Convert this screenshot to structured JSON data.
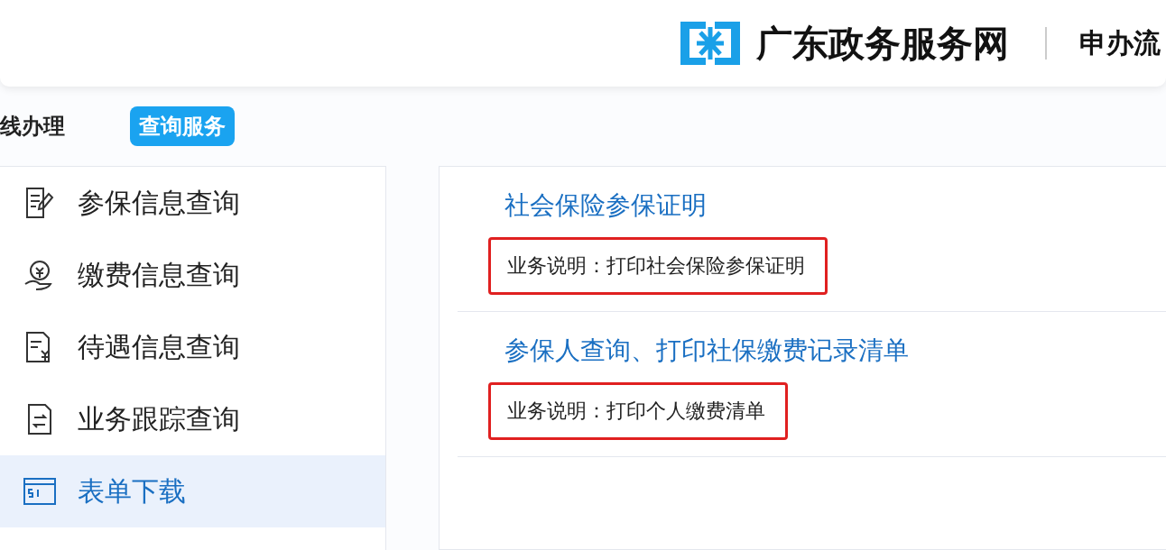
{
  "header": {
    "site_name": "广东政务服务网",
    "nav_link": "申办流"
  },
  "tabs": [
    {
      "label": "线办理",
      "selected": false
    },
    {
      "label": "查询服务",
      "selected": true
    }
  ],
  "sidebar": {
    "items": [
      {
        "label": "参保信息查询",
        "selected": false
      },
      {
        "label": "缴费信息查询",
        "selected": false
      },
      {
        "label": "待遇信息查询",
        "selected": false
      },
      {
        "label": "业务跟踪查询",
        "selected": false
      },
      {
        "label": "表单下载",
        "selected": true
      }
    ]
  },
  "services": [
    {
      "title": "社会保险参保证明",
      "description": "业务说明：打印社会保险参保证明",
      "highlighted": true
    },
    {
      "title": "参保人查询、打印社保缴费记录清单",
      "description": "业务说明：打印个人缴费清单",
      "highlighted": true
    }
  ]
}
